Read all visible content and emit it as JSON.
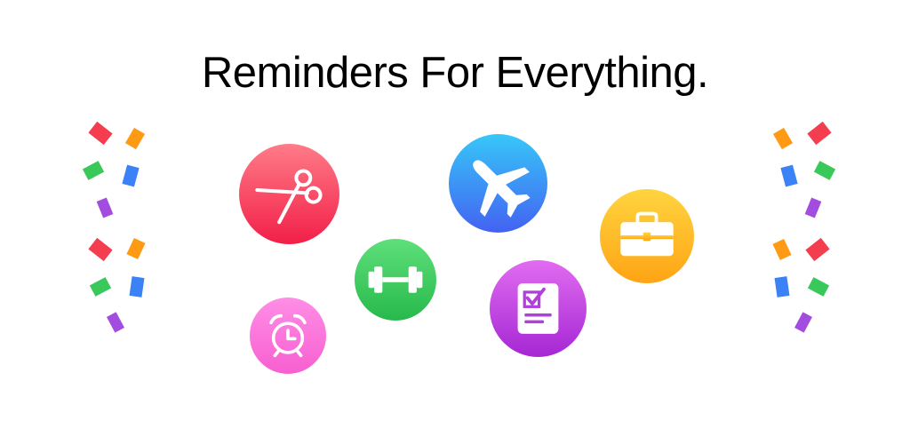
{
  "headline": "Reminders For Everything.",
  "icons": [
    {
      "name": "scissors-icon",
      "gradient": [
        "#ff7b88",
        "#f21f48"
      ]
    },
    {
      "name": "airplane-icon",
      "gradient": [
        "#37c7f8",
        "#4362f2"
      ]
    },
    {
      "name": "briefcase-icon",
      "gradient": [
        "#ffd43f",
        "#ffa414"
      ]
    },
    {
      "name": "dumbbell-icon",
      "gradient": [
        "#5fdf7a",
        "#27b94c"
      ]
    },
    {
      "name": "checklist-icon",
      "gradient": [
        "#e16cf0",
        "#a527d4"
      ]
    },
    {
      "name": "alarm-clock-icon",
      "gradient": [
        "#ff8ee6",
        "#f75fd0"
      ]
    }
  ],
  "confetti_colors": {
    "red": "#f43d4f",
    "orange": "#ff9a14",
    "green": "#38c95a",
    "blue": "#3b82f6",
    "purple": "#a34de0"
  }
}
